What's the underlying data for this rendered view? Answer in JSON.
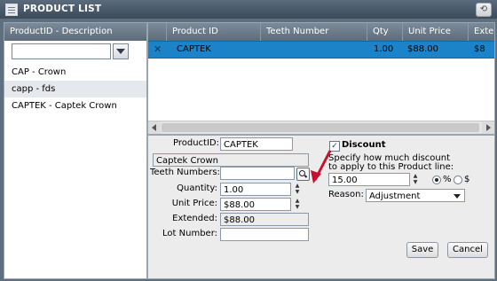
{
  "window": {
    "title": "PRODUCT LIST"
  },
  "product_list": {
    "header": "ProductID - Description",
    "filter": {
      "value": ""
    },
    "items": [
      {
        "label": "CAP - Crown"
      },
      {
        "label": "capp - fds"
      },
      {
        "label": "CAPTEK - Captek Crown"
      }
    ]
  },
  "grid": {
    "columns": [
      "Product ID",
      "Teeth Number",
      "Qty",
      "Unit Price",
      "Exte"
    ],
    "rows": [
      {
        "product_id": "CAPTEK",
        "teeth_number": "",
        "qty": "1.00",
        "unit_price": "$88.00",
        "extended": "$8"
      }
    ]
  },
  "detail": {
    "product_id_label": "ProductID:",
    "product_id": "CAPTEK",
    "description": "Captek Crown",
    "teeth_label": "Teeth Numbers:",
    "teeth_value": "",
    "quantity_label": "Quantity:",
    "quantity": "1.00",
    "unit_price_label": "Unit Price:",
    "unit_price": "$88.00",
    "extended_label": "Extended:",
    "extended": "$88.00",
    "lot_label": "Lot Number:",
    "lot_value": "",
    "discount": {
      "label": "Discount",
      "checked": true,
      "instructions": "Specify how much discount to apply to this Product line:",
      "amount": "15.00",
      "percent_label": "%",
      "dollar_label": "$",
      "mode": "percent",
      "reason_label": "Reason:",
      "reason_value": "Adjustment"
    },
    "save_label": "Save",
    "cancel_label": "Cancel"
  },
  "colors": {
    "selection": "#1c83c9",
    "annotation_arrow": "#c8102e"
  }
}
